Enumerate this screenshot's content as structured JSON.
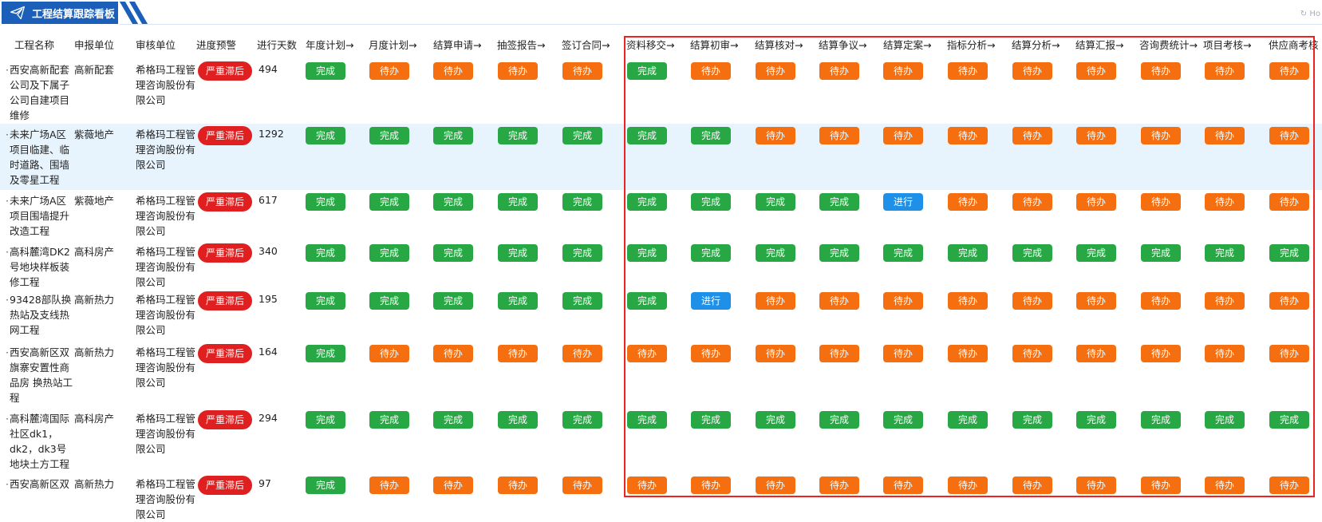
{
  "header": {
    "title": "工程结算跟踪看板",
    "refresh_hint": "Ho"
  },
  "columns": [
    "工程名称",
    "申报单位",
    "审核单位",
    "进度预警",
    "进行天数",
    "年度计划→",
    "月度计划→",
    "结算申请→",
    "抽签报告→",
    "签订合同→",
    "资料移交→",
    "结算初审→",
    "结算核对→",
    "结算争议→",
    "结算定案→",
    "指标分析→",
    "结算分析→",
    "结算汇报→",
    "咨询费统计→",
    "项目考核→",
    "供应商考核"
  ],
  "status_labels": {
    "done": "完成",
    "todo": "待办",
    "prog": "进行"
  },
  "colors": {
    "done": "#27a844",
    "todo": "#f56e10",
    "prog": "#1e90e8",
    "warn": "#e02020",
    "title_bg": "#1c5fb8",
    "highlight_row": "#e8f4fd",
    "red_box": "#ee2222"
  },
  "rows": [
    {
      "name": "西安高新配套公司及下属子公司自建项目维修",
      "unit": "高新配套",
      "auditor": "希格玛工程管理咨询股份有限公司",
      "warning": "严重滞后",
      "days": "494",
      "statuses": [
        "done",
        "todo",
        "todo",
        "todo",
        "todo",
        "done",
        "todo",
        "todo",
        "todo",
        "todo",
        "todo",
        "todo",
        "todo",
        "todo",
        "todo",
        "todo"
      ]
    },
    {
      "name": "未来广场A区项目临建、临时道路、围墙及零星工程",
      "unit": "紫薇地产",
      "auditor": "希格玛工程管理咨询股份有限公司",
      "warning": "严重滞后",
      "days": "1292",
      "statuses": [
        "done",
        "done",
        "done",
        "done",
        "done",
        "done",
        "done",
        "todo",
        "todo",
        "todo",
        "todo",
        "todo",
        "todo",
        "todo",
        "todo",
        "todo"
      ]
    },
    {
      "name": "未来广场A区项目围墙提升改造工程",
      "unit": "紫薇地产",
      "auditor": "希格玛工程管理咨询股份有限公司",
      "warning": "严重滞后",
      "days": "617",
      "statuses": [
        "done",
        "done",
        "done",
        "done",
        "done",
        "done",
        "done",
        "done",
        "done",
        "prog",
        "todo",
        "todo",
        "todo",
        "todo",
        "todo",
        "todo"
      ]
    },
    {
      "name": "高科麓湾DK2号地块样板装修工程",
      "unit": "高科房产",
      "auditor": "希格玛工程管理咨询股份有限公司",
      "warning": "严重滞后",
      "days": "340",
      "statuses": [
        "done",
        "done",
        "done",
        "done",
        "done",
        "done",
        "done",
        "done",
        "done",
        "done",
        "done",
        "done",
        "done",
        "done",
        "done",
        "done"
      ]
    },
    {
      "name": "93428部队换热站及支线热网工程",
      "unit": "高新热力",
      "auditor": "希格玛工程管理咨询股份有限公司",
      "warning": "严重滞后",
      "days": "195",
      "statuses": [
        "done",
        "done",
        "done",
        "done",
        "done",
        "done",
        "prog",
        "todo",
        "todo",
        "todo",
        "todo",
        "todo",
        "todo",
        "todo",
        "todo",
        "todo"
      ]
    },
    {
      "name": "西安高新区双旗寨安置性商品房 换热站工程",
      "unit": "高新热力",
      "auditor": "希格玛工程管理咨询股份有限公司",
      "warning": "严重滞后",
      "days": "164",
      "statuses": [
        "done",
        "todo",
        "todo",
        "todo",
        "todo",
        "todo",
        "todo",
        "todo",
        "todo",
        "todo",
        "todo",
        "todo",
        "todo",
        "todo",
        "todo",
        "todo"
      ]
    },
    {
      "name": "高科麓湾国际社区dk1，dk2，dk3号地块土方工程",
      "unit": "高科房产",
      "auditor": "希格玛工程管理咨询股份有限公司",
      "warning": "严重滞后",
      "days": "294",
      "statuses": [
        "done",
        "done",
        "done",
        "done",
        "done",
        "done",
        "done",
        "done",
        "done",
        "done",
        "done",
        "done",
        "done",
        "done",
        "done",
        "done"
      ]
    },
    {
      "name": "西安高新区双",
      "unit": "高新热力",
      "auditor": "希格玛工程管理咨询股份有限公司",
      "warning": "严重滞后",
      "days": "97",
      "statuses": [
        "done",
        "todo",
        "todo",
        "todo",
        "todo",
        "todo",
        "todo",
        "todo",
        "todo",
        "todo",
        "todo",
        "todo",
        "todo",
        "todo",
        "todo",
        "todo"
      ]
    }
  ]
}
